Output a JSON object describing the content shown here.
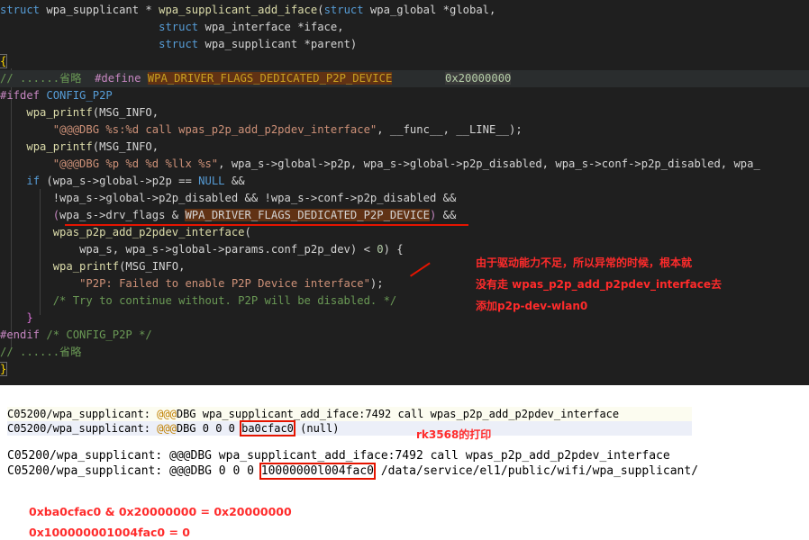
{
  "code": {
    "l1": {
      "kw1": "struct",
      "t1": " wpa_supplicant * ",
      "fn": "wpa_supplicant_add_iface",
      "p1": "(",
      "kw2": "struct",
      "t2": " wpa_global *global,"
    },
    "l2": {
      "indent": "                        ",
      "kw": "struct",
      "t": " wpa_interface *iface,"
    },
    "l3": {
      "indent": "                        ",
      "kw": "struct",
      "t": " wpa_supplicant *parent)"
    },
    "l4": {
      "brace": "{"
    },
    "l5": {
      "cm": "// ......省略  ",
      "define": "#define ",
      "macro": "WPA_DRIVER_FLAGS_DEDICATED_P2P_DEVICE",
      "gap": "        ",
      "num": "0x20000000"
    },
    "l6": {
      "pp": "#ifdef",
      "macro": " CONFIG_P2P"
    },
    "l7": {
      "indent": "    ",
      "fn": "wpa_printf",
      "t": "(MSG_INFO,"
    },
    "l8": {
      "indent": "        ",
      "str": "\"@@@DBG %s:%d call wpas_p2p_add_p2pdev_interface\"",
      "t": ", __func__, __LINE__);"
    },
    "l9": {
      "indent": "    ",
      "fn": "wpa_printf",
      "t": "(MSG_INFO,"
    },
    "l10": {
      "indent": "        ",
      "str": "\"@@@DBG %p %d %d %llx %s\"",
      "t": ", wpa_s->global->p2p, wpa_s->global->p2p_disabled, wpa_s->conf->p2p_disabled, wpa_"
    },
    "l11": {
      "indent": "    ",
      "kw": "if",
      "t1": " (wpa_s->global->p2p == ",
      "null": "NULL",
      "t2": " &&"
    },
    "l12": {
      "indent": "        ",
      "t": "!wpa_s->global->p2p_disabled && !wpa_s->conf->p2p_disabled &&"
    },
    "l13": {
      "indent": "        ",
      "p": "(",
      "t": "wpa_s->drv_flags & ",
      "macro": "WPA_DRIVER_FLAGS_DEDICATED_P2P_DEVICE",
      "pc": ")",
      "t2": " &&"
    },
    "l14": {
      "indent": "        ",
      "fn": "wpas_p2p_add_p2pdev_interface",
      "t": "("
    },
    "l15": {
      "indent": "            ",
      "t": "wpa_s, wpa_s->global->params.conf_p2p_dev) < ",
      "num": "0",
      "t2": ") {"
    },
    "l16": {
      "indent": "        ",
      "fn": "wpa_printf",
      "t": "(MSG_INFO,"
    },
    "l17": {
      "indent": "            ",
      "str": "\"P2P: Failed to enable P2P Device interface\"",
      "t": ");"
    },
    "l18": {
      "indent": "        ",
      "cm": "/* Try to continue without. P2P will be disabled. */"
    },
    "l19": {
      "indent": "    ",
      "brace": "}"
    },
    "l20": {
      "pp": "#endif",
      "cm": " /* CONFIG_P2P */"
    },
    "l21": {
      "cm": "// ......省略"
    },
    "l22": {
      "brace": "}"
    }
  },
  "annotation": {
    "line1": "由于驱动能力不足，所以异常的时候，根本就",
    "line2": "没有走 wpas_p2p_add_p2pdev_interface去",
    "line3": "添加p2p-dev-wlan0"
  },
  "logs": {
    "row1": {
      "prefix": "C05200/wpa_supplicant: ",
      "at": "@@@",
      "rest": "DBG wpa_supplicant_add_iface:7492 call wpas_p2p_add_p2pdev_interface"
    },
    "row2": {
      "prefix": "C05200/wpa_supplicant: ",
      "at": "@@@",
      "mid": "DBG 0 0 0 ",
      "boxed": "ba0cfac0",
      "rest": " (null)"
    },
    "rk_label": "rk3568的打印",
    "row3": {
      "text": "C05200/wpa_supplicant: @@@DBG wpa_supplicant_add_iface:7492 call wpas_p2p_add_p2pdev_interface"
    },
    "row4": {
      "prefix": "C05200/wpa_supplicant: @@@DBG 0 0 0 ",
      "boxed": "10000000l004fac0",
      "rest": " /data/service/el1/public/wifi/wpa_supplicant/"
    }
  },
  "calc": {
    "line1": "0xba0cfac0 & 0x20000000 = 0x20000000",
    "line2": "0x100000001004fac0 = 0"
  }
}
